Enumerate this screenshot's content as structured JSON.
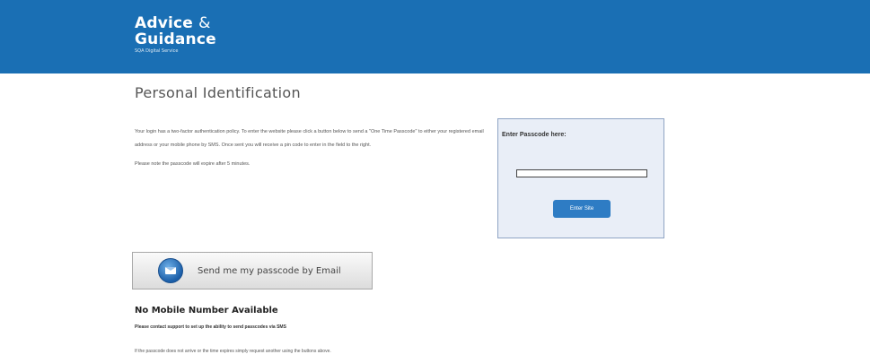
{
  "header": {
    "logo_line1": "Advice",
    "logo_amp": "&",
    "logo_line2": "Guidance",
    "logo_sub": "SQA Digital Service",
    "background": "#1a6fb4"
  },
  "page": {
    "title": "Personal Identification"
  },
  "intro": {
    "text": "Your login has a two-factor authentication policy. To enter the website please click a button below to send a \"One Time Passcode\" to either your registered email address or your mobile phone by SMS. Once sent you will receive a pin code to enter in the field to the right.",
    "note": "Please note the passcode will expire after 5 minutes."
  },
  "passcode": {
    "label": "Enter Passcode here:",
    "input_value": "",
    "button_label": "Enter Site"
  },
  "email_button": {
    "label": "Send me my passcode by Email",
    "icon": "envelope-icon"
  },
  "no_mobile": {
    "title": "No Mobile Number Available",
    "text": "Please contact support to set up the ability to send passcodes via SMS"
  },
  "footer_note": "If the passcode does not arrive or the time expires simply request another using the buttons above."
}
